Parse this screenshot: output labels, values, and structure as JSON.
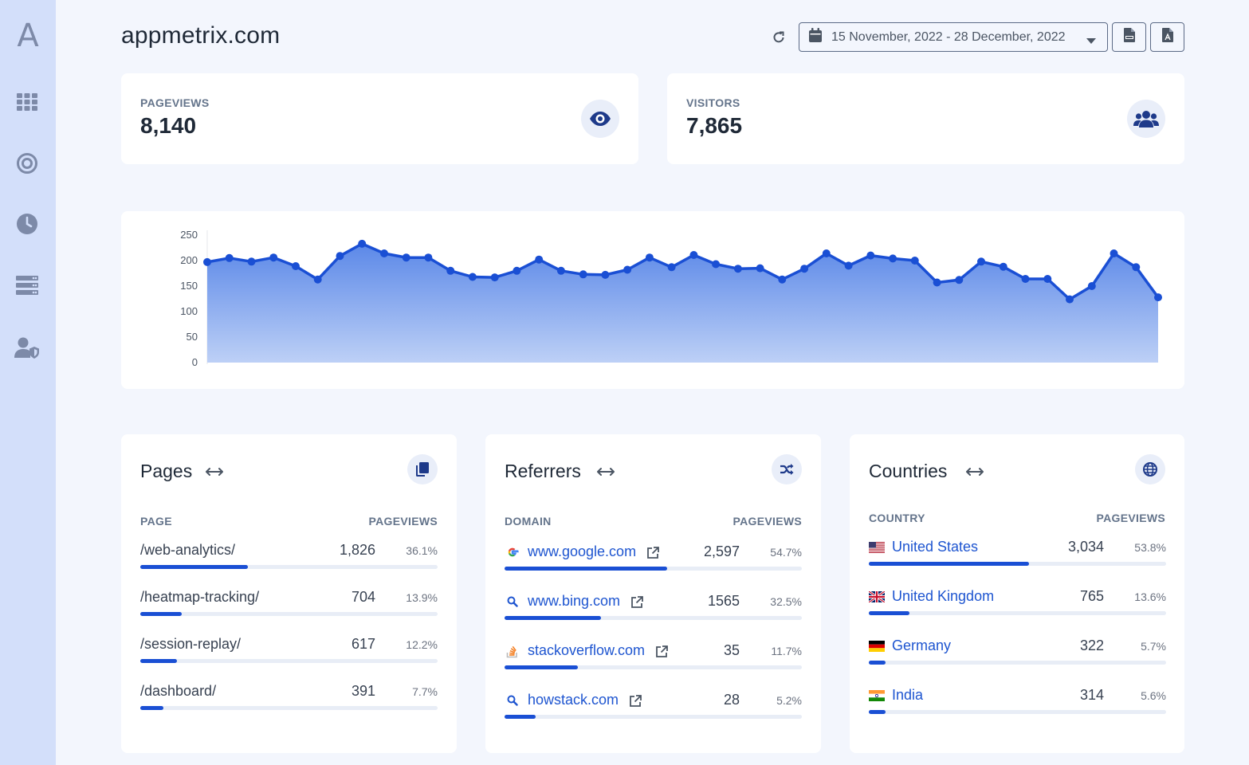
{
  "app": {
    "logo": "A",
    "title": "appmetrix.com"
  },
  "toolbar": {
    "date_range": "15 November, 2022 - 28 December, 2022",
    "refresh_icon": "refresh-icon",
    "export_csv_icon": "csv-file-icon",
    "export_pdf_icon": "pdf-file-icon"
  },
  "sidebar": {
    "items": [
      {
        "name": "dashboard",
        "icon": "grid-icon"
      },
      {
        "name": "goals",
        "icon": "target-icon"
      },
      {
        "name": "realtime",
        "icon": "clock-icon"
      },
      {
        "name": "servers",
        "icon": "server-icon"
      },
      {
        "name": "users",
        "icon": "user-shield-icon"
      }
    ]
  },
  "stats": {
    "pageviews": {
      "label": "PAGEVIEWS",
      "value": "8,140",
      "icon": "eye-icon"
    },
    "visitors": {
      "label": "VISITORS",
      "value": "7,865",
      "icon": "users-icon"
    }
  },
  "chart_data": {
    "type": "area",
    "ylim": [
      0,
      250
    ],
    "yticks": [
      "0",
      "50",
      "100",
      "150",
      "200",
      "250"
    ],
    "grid": false,
    "color": "#1a4fd4",
    "values": [
      197,
      205,
      198,
      206,
      189,
      163,
      209,
      233,
      214,
      206,
      206,
      180,
      168,
      167,
      180,
      202,
      180,
      173,
      172,
      182,
      206,
      187,
      211,
      193,
      184,
      185,
      163,
      184,
      214,
      190,
      210,
      204,
      200,
      157,
      162,
      198,
      188,
      164,
      164,
      124,
      150,
      214,
      187,
      128
    ]
  },
  "pages": {
    "title": "Pages",
    "icon": "copy-icon",
    "col_left": "PAGE",
    "col_right": "PAGEVIEWS",
    "rows": [
      {
        "label": "/web-analytics/",
        "count": "1,826",
        "pct": "36.1%",
        "share": 0.361
      },
      {
        "label": "/heatmap-tracking/",
        "count": "704",
        "pct": "13.9%",
        "share": 0.139
      },
      {
        "label": "/session-replay/",
        "count": "617",
        "pct": "12.2%",
        "share": 0.122
      },
      {
        "label": "/dashboard/",
        "count": "391",
        "pct": "7.7%",
        "share": 0.077
      }
    ]
  },
  "referrers": {
    "title": "Referrers",
    "icon": "shuffle-icon",
    "col_left": "DOMAIN",
    "col_right": "PAGEVIEWS",
    "rows": [
      {
        "label": "www.google.com",
        "count": "2,597",
        "pct": "54.7%",
        "share": 0.547,
        "icon": "google-icon"
      },
      {
        "label": "www.bing.com",
        "count": "1565",
        "pct": "32.5%",
        "share": 0.325,
        "icon": "search-icon"
      },
      {
        "label": "stackoverflow.com",
        "count": "35",
        "pct": "11.7%",
        "share": 0.247,
        "icon": "stackoverflow-icon"
      },
      {
        "label": "howstack.com",
        "count": "28",
        "pct": "5.2%",
        "share": 0.105,
        "icon": "search-icon"
      }
    ]
  },
  "countries": {
    "title": "Countries",
    "icon": "globe-icon",
    "col_left": "COUNTRY",
    "col_right": "PAGEVIEWS",
    "rows": [
      {
        "label": "United States",
        "count": "3,034",
        "pct": "53.8%",
        "share": 0.538,
        "flag": "us-flag-icon"
      },
      {
        "label": "United Kingdom",
        "count": "765",
        "pct": "13.6%",
        "share": 0.136,
        "flag": "uk-flag-icon"
      },
      {
        "label": "Germany",
        "count": "322",
        "pct": "5.7%",
        "share": 0.057,
        "flag": "de-flag-icon"
      },
      {
        "label": "India",
        "count": "314",
        "pct": "5.6%",
        "share": 0.056,
        "flag": "in-flag-icon"
      }
    ]
  }
}
